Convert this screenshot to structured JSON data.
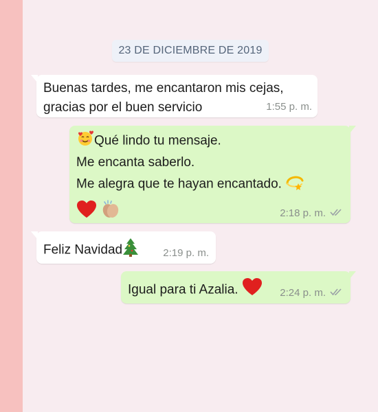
{
  "date_separator": "23 DE DICIEMBRE DE 2019",
  "messages": [
    {
      "direction": "incoming",
      "lines": [
        "Buenas tardes, me encantaron mis cejas,",
        "gracias por el buen servicio"
      ],
      "time": "1:55 p. m."
    },
    {
      "direction": "outgoing",
      "lines": [
        "Qué lindo tu mensaje.",
        "Me encanta saberlo.",
        "Me alegra que te hayan encantado."
      ],
      "emojis": [
        "smiling-face-with-hearts",
        "dizzy",
        "red-heart",
        "clapping-hands"
      ],
      "time": "2:18 p. m.",
      "status": "read"
    },
    {
      "direction": "incoming",
      "lines": [
        "Feliz Navidad"
      ],
      "emojis": [
        "christmas-tree"
      ],
      "time": "2:19 p. m."
    },
    {
      "direction": "outgoing",
      "lines": [
        "Igual para ti Azalia."
      ],
      "emojis": [
        "red-heart"
      ],
      "time": "2:24 p. m.",
      "status": "read"
    }
  ],
  "colors": {
    "incoming_bubble": "#ffffff",
    "outgoing_bubble": "#dcf8c6",
    "background": "#f8ecf0",
    "left_strip": "#f7c1bf",
    "read_ticks": "#9aa0a6"
  }
}
